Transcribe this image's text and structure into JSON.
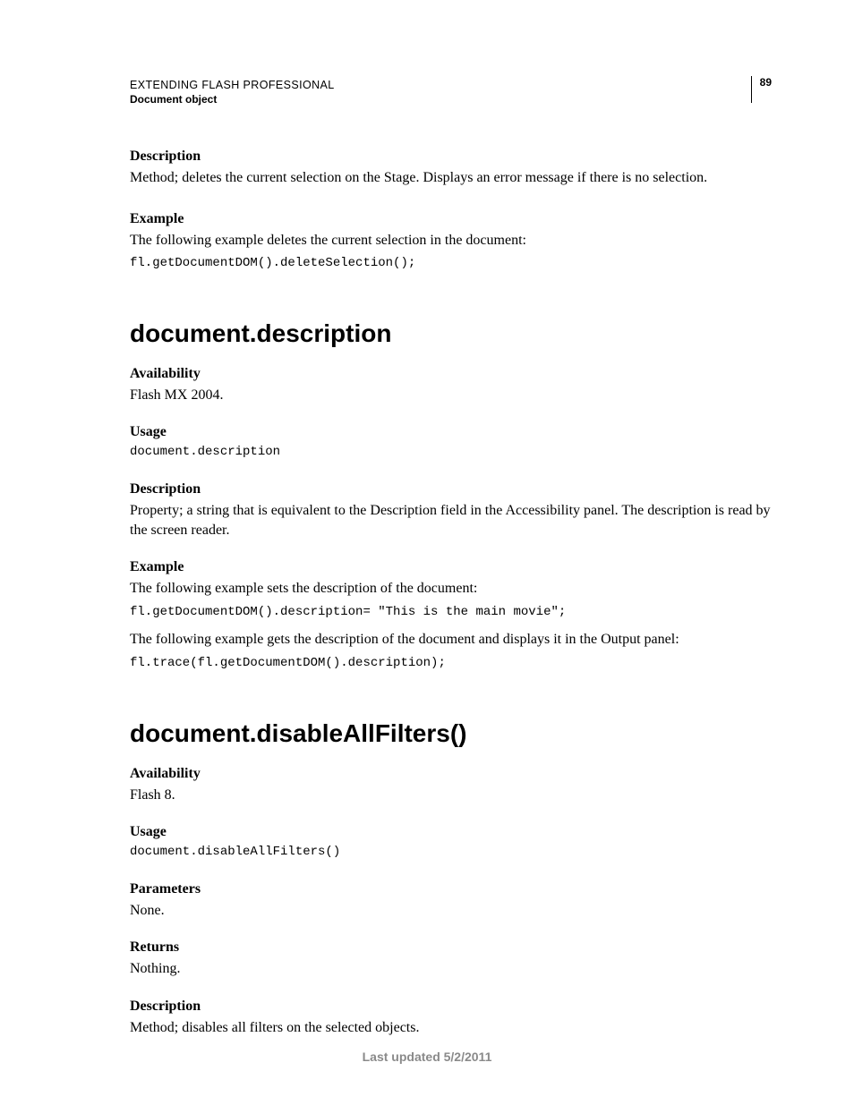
{
  "header": {
    "title": "EXTENDING FLASH PROFESSIONAL",
    "subtitle": "Document object",
    "page_number": "89"
  },
  "block1": {
    "desc_label": "Description",
    "desc_text": "Method; deletes the current selection on the Stage. Displays an error message if there is no selection.",
    "example_label": "Example",
    "example_text": "The following example deletes the current selection in the document:",
    "example_code": "fl.getDocumentDOM().deleteSelection();"
  },
  "sec2": {
    "heading": "document.description",
    "avail_label": "Availability",
    "avail_text": "Flash MX 2004.",
    "usage_label": "Usage",
    "usage_code": "document.description",
    "desc_label": "Description",
    "desc_text": "Property; a string that is equivalent to the Description field in the Accessibility panel. The description is read by the screen reader.",
    "example_label": "Example",
    "example_text1": "The following example sets the description of the document:",
    "example_code1": "fl.getDocumentDOM().description= \"This is the main movie\";",
    "example_text2": "The following example gets the description of the document and displays it in the Output panel:",
    "example_code2": "fl.trace(fl.getDocumentDOM().description);"
  },
  "sec3": {
    "heading": "document.disableAllFilters()",
    "avail_label": "Availability",
    "avail_text": "Flash 8.",
    "usage_label": "Usage",
    "usage_code": "document.disableAllFilters()",
    "params_label": "Parameters",
    "params_text": "None.",
    "returns_label": "Returns",
    "returns_text": "Nothing.",
    "desc_label": "Description",
    "desc_text": "Method; disables all filters on the selected objects."
  },
  "footer": {
    "text": "Last updated 5/2/2011"
  }
}
